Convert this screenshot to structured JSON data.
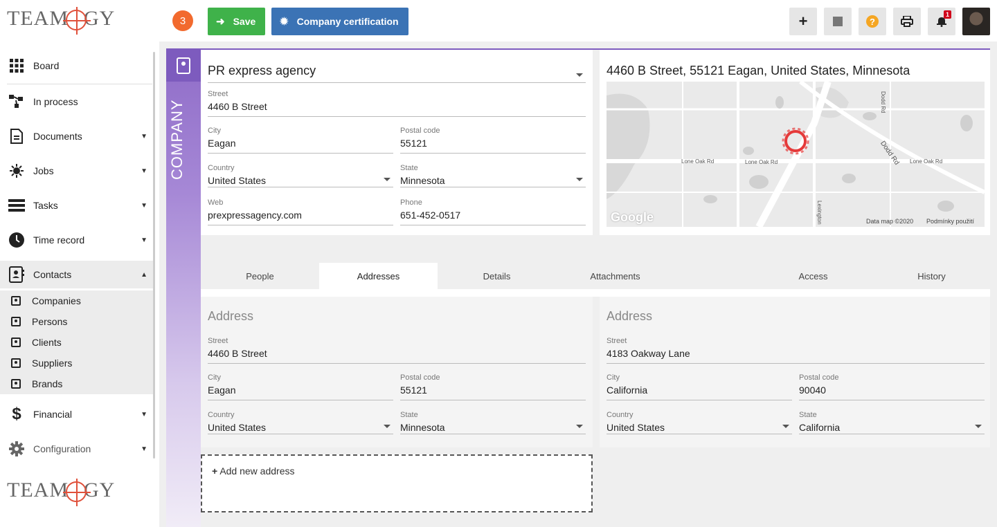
{
  "topbar": {
    "counter": "3",
    "save_label": "Save",
    "cert_label": "Company certification",
    "notification_count": "1"
  },
  "logo": {
    "text_left": "TEAM",
    "text_right": "GY"
  },
  "sidebar": {
    "items": [
      {
        "label": "Board"
      },
      {
        "label": "In process"
      },
      {
        "label": "Documents"
      },
      {
        "label": "Jobs"
      },
      {
        "label": "Tasks"
      },
      {
        "label": "Time record"
      },
      {
        "label": "Contacts"
      },
      {
        "label": "Financial"
      },
      {
        "label": "Configuration"
      }
    ],
    "contacts_sub": [
      {
        "label": "Companies"
      },
      {
        "label": "Persons"
      },
      {
        "label": "Clients"
      },
      {
        "label": "Suppliers"
      },
      {
        "label": "Brands"
      }
    ]
  },
  "strip_label": "COMPANY",
  "company": {
    "name": "PR express agency",
    "street_label": "Street",
    "street": "4460  B Street",
    "city_label": "City",
    "city": "Eagan",
    "postal_label": "Postal code",
    "postal": "55121",
    "country_label": "Country",
    "country": "United States",
    "state_label": "State",
    "state": "Minnesota",
    "web_label": "Web",
    "web": "prexpressagency.com",
    "phone_label": "Phone",
    "phone": "651-452-0517"
  },
  "map": {
    "title": "4460 B Street, 55121 Eagan, United States, Minnesota",
    "road1": "Lone Oak Rd",
    "road2": "Lone Oak Rd",
    "road3": "Lone Oak Rd",
    "road4": "Dodd Rd",
    "road5": "Dodd Rd",
    "road6": "Lexington",
    "brand": "Google",
    "footer1": "Data map ©2020",
    "footer2": "Podmínky použití"
  },
  "tabs": [
    {
      "label": "People"
    },
    {
      "label": "Addresses"
    },
    {
      "label": "Details"
    },
    {
      "label": "Attachments"
    },
    {
      "label": "Access"
    },
    {
      "label": "History"
    }
  ],
  "addresses": [
    {
      "title": "Address",
      "street_label": "Street",
      "street": "4460  B Street",
      "city_label": "City",
      "city": "Eagan",
      "postal_label": "Postal code",
      "postal": "55121",
      "country_label": "Country",
      "country": "United States",
      "state_label": "State",
      "state": "Minnesota"
    },
    {
      "title": "Address",
      "street_label": "Street",
      "street": "4183  Oakway Lane",
      "city_label": "City",
      "city": "California",
      "postal_label": "Postal code",
      "postal": "90040",
      "country_label": "Country",
      "country": "United States",
      "state_label": "State",
      "state": "California"
    }
  ],
  "add_address_label": "Add new address",
  "colors": {
    "accent": "#7d5bbe",
    "save": "#3fb24a",
    "cert": "#3b73b5",
    "counter": "#f26a2e"
  }
}
